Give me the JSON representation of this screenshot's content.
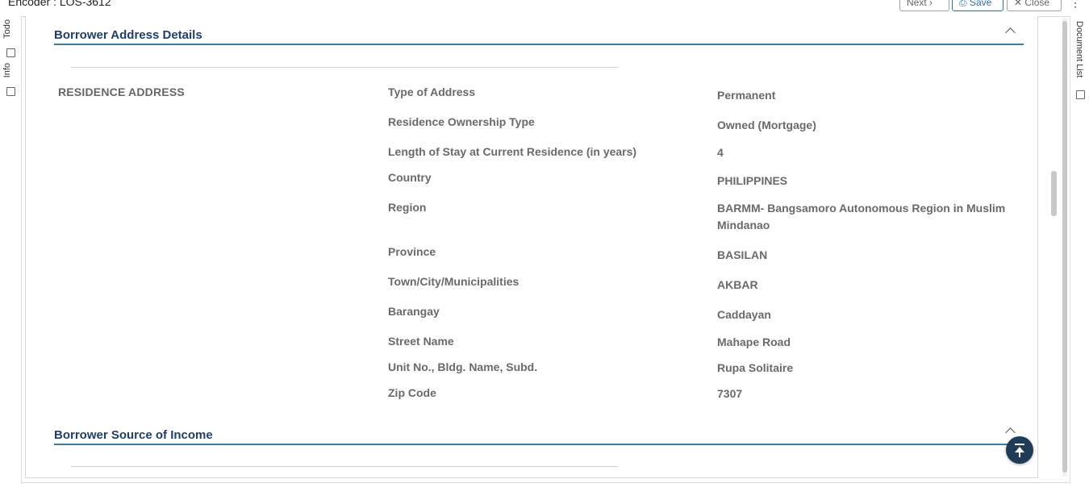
{
  "window": {
    "title": "Encoder : LOS-3612"
  },
  "toolbar": {
    "next_label": "Next ›",
    "save_label": "⎙ Save",
    "close_label": "✕ Close",
    "more_label": "⋮"
  },
  "left_tabs": {
    "todo": "Todo",
    "info": "Info"
  },
  "right_tabs": {
    "document_list": "Document List"
  },
  "address_section": {
    "title": "Borrower Address Details",
    "group_label": "RESIDENCE ADDRESS",
    "fields": [
      {
        "label": "Type of Address",
        "value": "Permanent"
      },
      {
        "label": "Residence Ownership Type",
        "value": "Owned (Mortgage)"
      },
      {
        "label": "Length of Stay at Current Residence (in years)",
        "value": "4"
      },
      {
        "label": "Country",
        "value": "PHILIPPINES"
      },
      {
        "label": "Region",
        "value": "BARMM- Bangsamoro Autonomous Region in Muslim Mindanao"
      },
      {
        "label": "Province",
        "value": "BASILAN"
      },
      {
        "label": "Town/City/Municipalities",
        "value": "AKBAR"
      },
      {
        "label": "Barangay",
        "value": "Caddayan"
      },
      {
        "label": "Street Name",
        "value": "Mahape Road"
      },
      {
        "label": "Unit No., Bldg. Name, Subd.",
        "value": "Rupa Solitaire"
      },
      {
        "label": "Zip Code",
        "value": "7307"
      }
    ]
  },
  "income_section": {
    "title": "Borrower Source of Income"
  },
  "colors": {
    "accent": "#3a7ca5",
    "heading": "#1f3f6b",
    "fab": "#1f3b57"
  }
}
